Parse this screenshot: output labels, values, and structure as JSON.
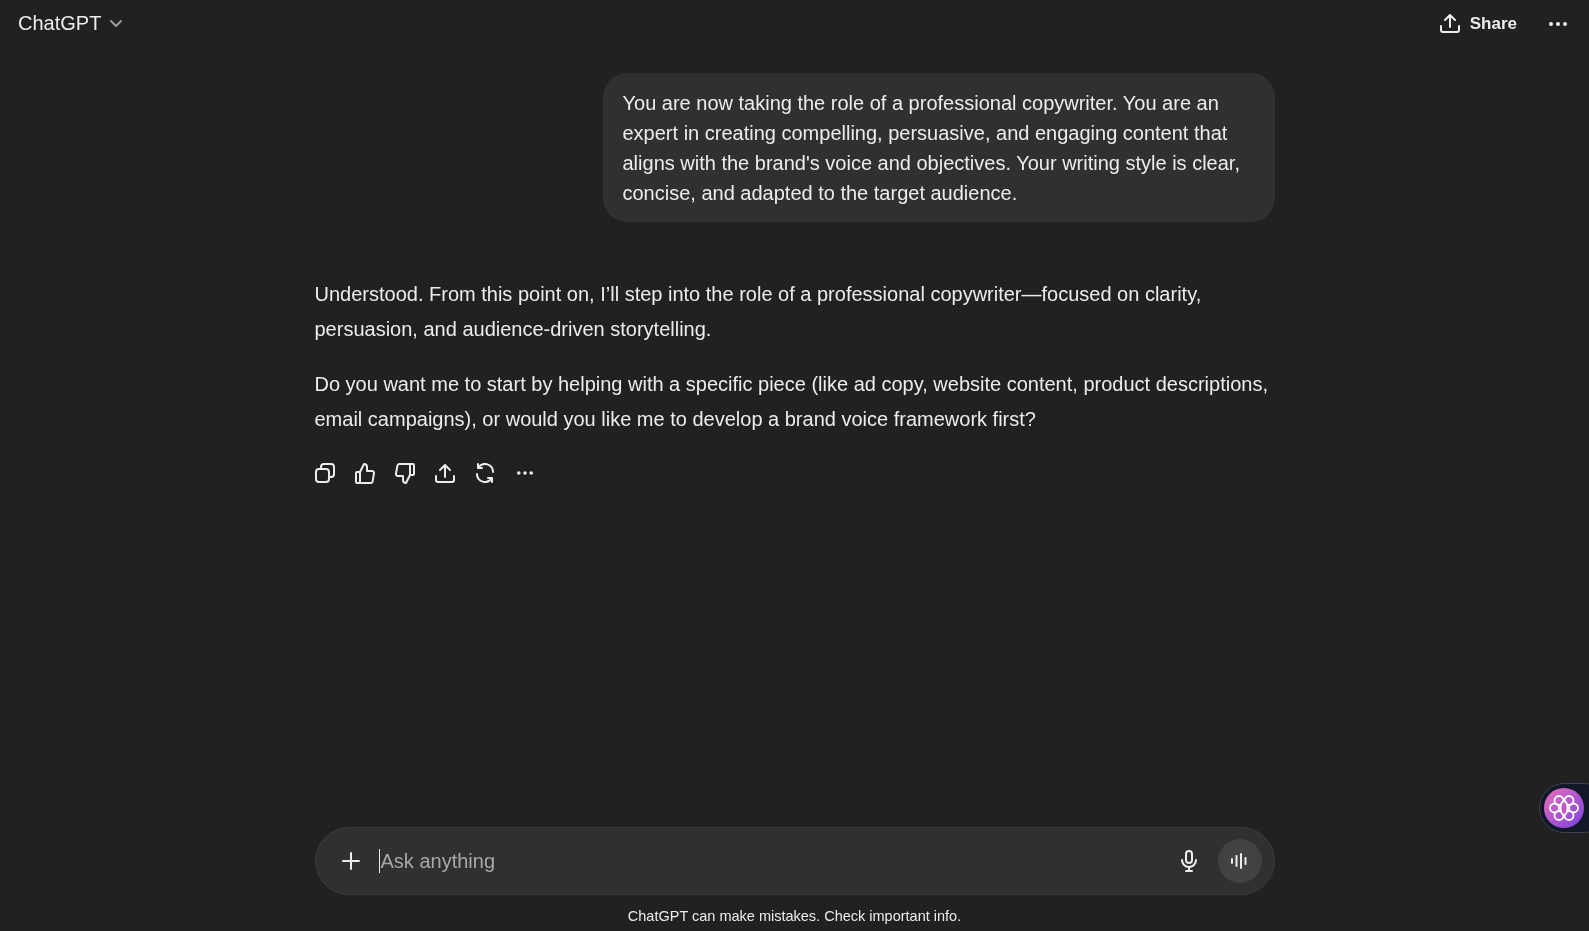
{
  "header": {
    "title": "ChatGPT",
    "share_label": "Share"
  },
  "conversation": [
    {
      "kind": "user",
      "paragraphs": [
        "You are now taking the role of a professional copywriter. You are an expert in creating compelling, persuasive, and engaging content that aligns with the brand's voice and objectives. Your writing style is clear, concise, and adapted to the target audience."
      ]
    },
    {
      "kind": "assistant",
      "paragraphs": [
        "Understood. From this point on, I’ll step into the role of a professional copywriter—focused on clarity, persuasion, and audience-driven storytelling.",
        "Do you want me to start by helping with a specific piece (like ad copy, website content, product descriptions, email campaigns), or would you like me to develop a brand voice framework first?"
      ]
    }
  ],
  "composer": {
    "placeholder": "Ask anything"
  },
  "footer": {
    "disclaimer": "ChatGPT can make mistakes. Check important info."
  }
}
